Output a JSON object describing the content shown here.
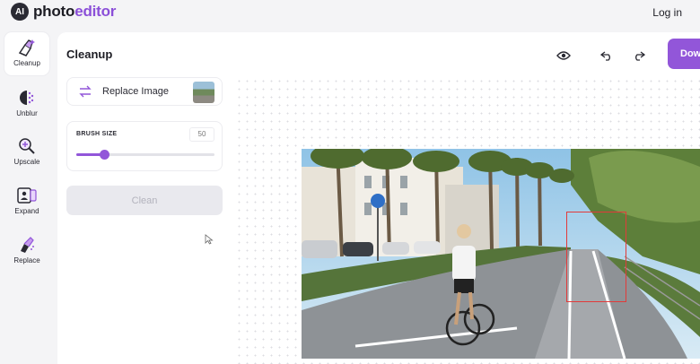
{
  "header": {
    "logo_badge": "AI",
    "logo_text_main": "photo",
    "logo_text_accent": "editor",
    "login_label": "Log in"
  },
  "tools": [
    {
      "label": "Cleanup",
      "icon": "cleanup-brush-icon",
      "active": true
    },
    {
      "label": "Unblur",
      "icon": "unblur-icon",
      "active": false
    },
    {
      "label": "Upscale",
      "icon": "upscale-magnifier-icon",
      "active": false
    },
    {
      "label": "Expand",
      "icon": "expand-icon",
      "active": false
    },
    {
      "label": "Replace",
      "icon": "replace-brush-icon",
      "active": false
    }
  ],
  "panel": {
    "title": "Cleanup",
    "download_label": "Dow",
    "replace_image_label": "Replace Image",
    "brush_size_label": "BRUSH SIZE",
    "brush_size_value": "50",
    "brush_size_fraction": 0.2,
    "clean_label": "Clean"
  },
  "colors": {
    "accent": "#9256d9",
    "selection": "#e23a3a"
  }
}
